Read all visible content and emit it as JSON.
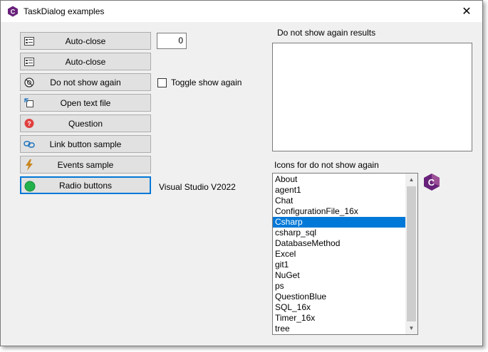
{
  "window": {
    "title": "TaskDialog examples",
    "close_glyph": "✕",
    "icon": "csharp-logo-icon"
  },
  "buttons": [
    {
      "label": "Auto-close",
      "icon": "dialog-icon"
    },
    {
      "label": "Auto-close",
      "icon": "dialog-icon"
    },
    {
      "label": "Do not show again",
      "icon": "eye-hide-icon"
    },
    {
      "label": "Open text file",
      "icon": "open-file-icon"
    },
    {
      "label": "Question",
      "icon": "question-icon"
    },
    {
      "label": "Link button sample",
      "icon": "link-icon"
    },
    {
      "label": "Events sample",
      "icon": "lightning-icon"
    },
    {
      "label": "Radio buttons",
      "icon": "radio-icon"
    }
  ],
  "numeric_value": "0",
  "toggle": {
    "label": "Toggle show again",
    "checked": false
  },
  "vs_label": "Visual Studio V2022",
  "results": {
    "label": "Do not show again results",
    "value": ""
  },
  "icons_list": {
    "label": "Icons for do not show again",
    "items": [
      "About",
      "agent1",
      "Chat",
      "ConfigurationFile_16x",
      "Csharp",
      "csharp_sql",
      "DatabaseMethod",
      "Excel",
      "git1",
      "NuGet",
      "ps",
      "QuestionBlue",
      "SQL_16x",
      "Timer_16x",
      "tree"
    ],
    "selected": "Csharp"
  },
  "colors": {
    "accent": "#0078d7",
    "csharp_purple": "#68217a",
    "question_red": "#e04040",
    "radio_green": "#22b14c",
    "lightning": "#c8861c"
  }
}
